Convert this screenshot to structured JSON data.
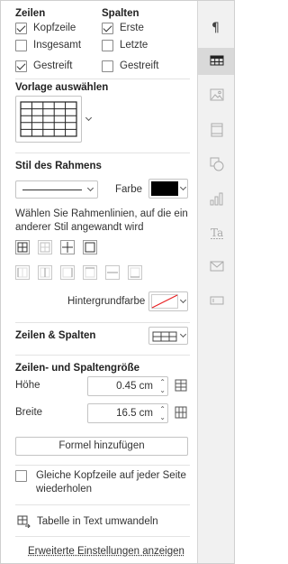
{
  "rows_header": "Zeilen",
  "columns_header": "Spalten",
  "rows": [
    {
      "label": "Kopfzeile",
      "checked": true
    },
    {
      "label": "Insgesamt",
      "checked": false
    },
    {
      "label": "Gestreift",
      "checked": true
    }
  ],
  "columns": [
    {
      "label": "Erste",
      "checked": true
    },
    {
      "label": "Letzte",
      "checked": false
    },
    {
      "label": "Gestreift",
      "checked": false
    }
  ],
  "template_title": "Vorlage auswählen",
  "border_style_title": "Stil des Rahmens",
  "color_label": "Farbe",
  "border_hint": "Wählen Sie Rahmenlinien, auf die ein anderer Stil angewandt wird",
  "background_label": "Hintergrundfarbe",
  "rows_cols_title": "Zeilen & Spalten",
  "size_title": "Zeilen- und Spaltengröße",
  "height_label": "Höhe",
  "height_value": "0.45 cm",
  "width_label": "Breite",
  "width_value": "16.5 cm",
  "formula_button": "Formel hinzufügen",
  "repeat_header": "Gleiche Kopfzeile auf jeder Seite wiederholen",
  "convert_link": "Tabelle in Text umwandeln",
  "advanced_link": "Erweiterte Einstellungen anzeigen",
  "colors": {
    "border_color": "#000000",
    "accent": "#333333"
  },
  "rail_icons": [
    "paragraph-icon",
    "table-icon",
    "image-icon",
    "header-footer-icon",
    "shape-icon",
    "chart-icon",
    "text-art-icon",
    "mail-merge-icon",
    "form-icon"
  ]
}
